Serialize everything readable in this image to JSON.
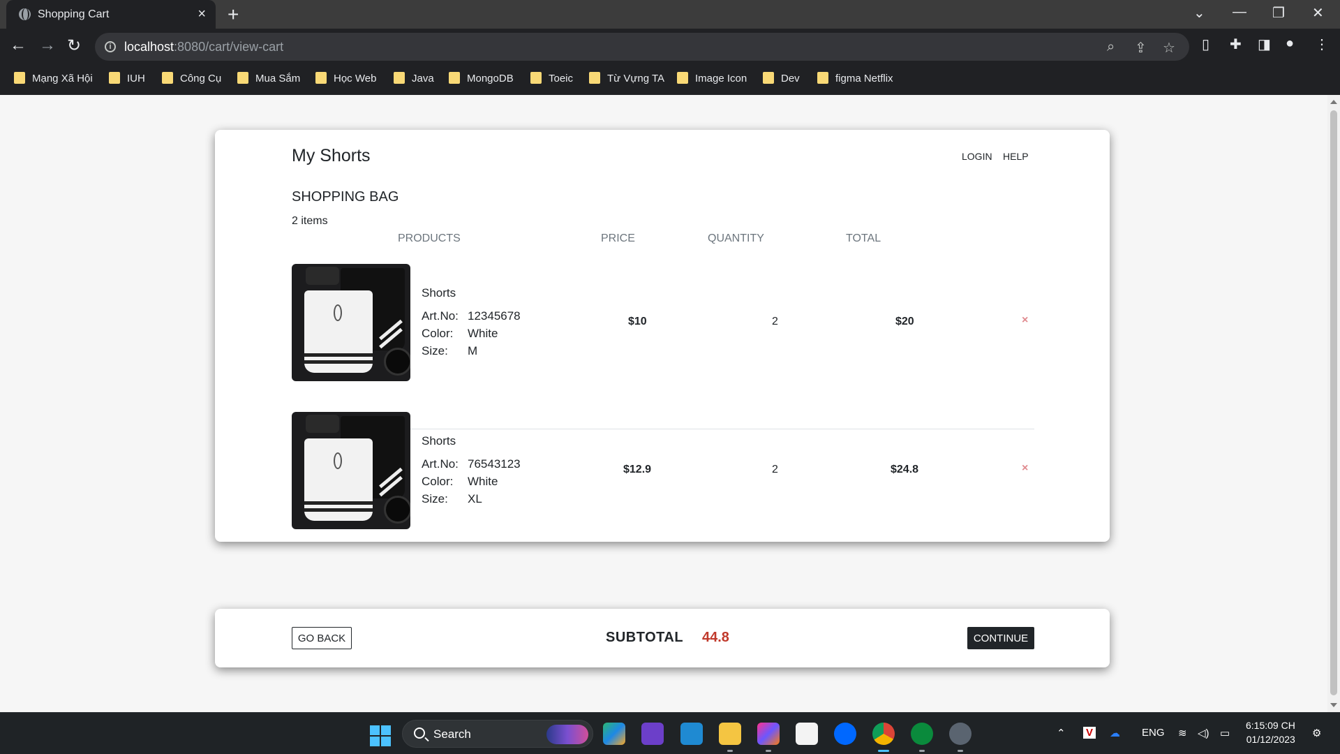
{
  "browser": {
    "tab_title": "Shopping Cart",
    "url_host": "localhost",
    "url_path": ":8080/cart/view-cart",
    "bookmarks": [
      "Mạng Xã Hội",
      "IUH",
      "Công Cụ",
      "Mua Sắm",
      "Học Web",
      "Java",
      "MongoDB",
      "Toeic",
      "Từ Vựng TA",
      "Image Icon",
      "Dev",
      "figma Netflix"
    ]
  },
  "header": {
    "brand": "My Shorts",
    "login": "LOGIN",
    "help": "HELP"
  },
  "cart": {
    "title": "SHOPPING BAG",
    "count": "2 items",
    "columns": {
      "products": "PRODUCTS",
      "price": "PRICE",
      "quantity": "QUANTITY",
      "total": "TOTAL"
    },
    "labels": {
      "art_no": "Art.No:",
      "color": "Color:",
      "size": "Size:"
    },
    "items": [
      {
        "name": "Shorts",
        "art_no": "12345678",
        "color": "White",
        "size": "M",
        "price": "$10",
        "quantity": "2",
        "total": "$20",
        "remove": "×"
      },
      {
        "name": "Shorts",
        "art_no": "76543123",
        "color": "White",
        "size": "XL",
        "price": "$12.9",
        "quantity": "2",
        "total": "$24.8",
        "remove": "×"
      }
    ]
  },
  "footer": {
    "go_back": "GO BACK",
    "subtotal_label": "SUBTOTAL",
    "subtotal_value": "44.8",
    "continue": "CONTINUE"
  },
  "taskbar": {
    "search": "Search",
    "language": "ENG",
    "time": "6:15:09 CH",
    "date": "01/12/2023"
  },
  "colors": {
    "accent_dark": "#212529",
    "subtotal": "#c0392b",
    "remove": "#e08a8f"
  }
}
